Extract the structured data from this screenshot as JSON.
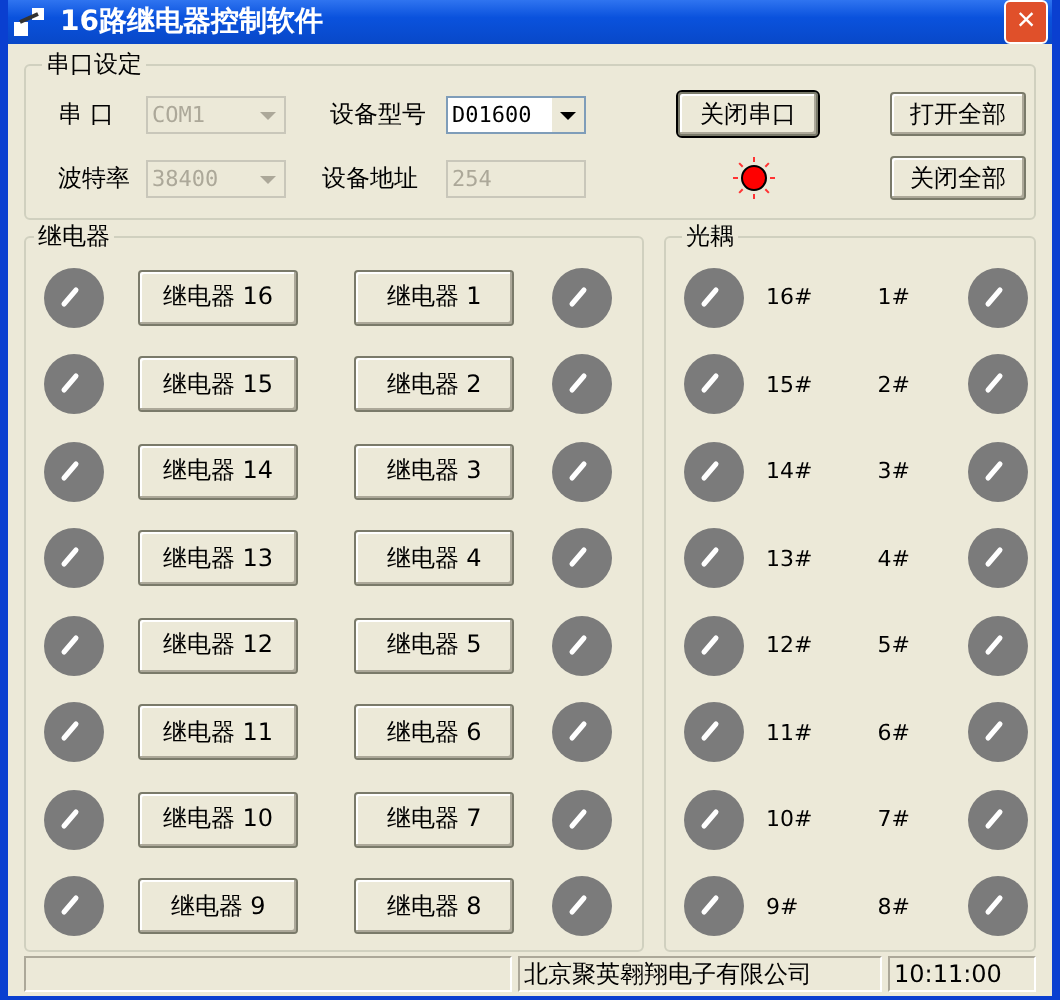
{
  "window": {
    "title": "16路继电器控制软件",
    "close": "×"
  },
  "serial": {
    "title": "串口设定",
    "port": {
      "label": "串 口",
      "value": "COM1",
      "disabled": true
    },
    "model": {
      "label": "设备型号",
      "value": "D01600",
      "disabled": false
    },
    "baud": {
      "label": "波特率",
      "value": "38400",
      "disabled": true
    },
    "address": {
      "label": "设备地址",
      "value": "254",
      "disabled": true
    },
    "toggle_button": "关闭串口",
    "open_all": "打开全部",
    "close_all": "关闭全部",
    "led_on": true
  },
  "relays": {
    "title": "继电器",
    "rows": [
      {
        "left": {
          "label": "继电器 16",
          "on": false
        },
        "right": {
          "label": "继电器 1",
          "on": false
        }
      },
      {
        "left": {
          "label": "继电器 15",
          "on": false
        },
        "right": {
          "label": "继电器 2",
          "on": false
        }
      },
      {
        "left": {
          "label": "继电器 14",
          "on": false
        },
        "right": {
          "label": "继电器 3",
          "on": false
        }
      },
      {
        "left": {
          "label": "继电器 13",
          "on": false
        },
        "right": {
          "label": "继电器 4",
          "on": false
        }
      },
      {
        "left": {
          "label": "继电器 12",
          "on": false
        },
        "right": {
          "label": "继电器 5",
          "on": false
        }
      },
      {
        "left": {
          "label": "继电器 11",
          "on": false
        },
        "right": {
          "label": "继电器 6",
          "on": false
        }
      },
      {
        "left": {
          "label": "继电器 10",
          "on": false
        },
        "right": {
          "label": "继电器 7",
          "on": false
        }
      },
      {
        "left": {
          "label": "继电器 9",
          "on": false
        },
        "right": {
          "label": "继电器 8",
          "on": false
        }
      }
    ]
  },
  "optocouplers": {
    "title": "光耦",
    "rows": [
      {
        "left": {
          "label": "16#",
          "on": false
        },
        "right": {
          "label": "1#",
          "on": false
        }
      },
      {
        "left": {
          "label": "15#",
          "on": false
        },
        "right": {
          "label": "2#",
          "on": false
        }
      },
      {
        "left": {
          "label": "14#",
          "on": false
        },
        "right": {
          "label": "3#",
          "on": false
        }
      },
      {
        "left": {
          "label": "13#",
          "on": false
        },
        "right": {
          "label": "4#",
          "on": false
        }
      },
      {
        "left": {
          "label": "12#",
          "on": false
        },
        "right": {
          "label": "5#",
          "on": false
        }
      },
      {
        "left": {
          "label": "11#",
          "on": false
        },
        "right": {
          "label": "6#",
          "on": false
        }
      },
      {
        "left": {
          "label": "10#",
          "on": false
        },
        "right": {
          "label": "7#",
          "on": false
        }
      },
      {
        "left": {
          "label": "9#",
          "on": false
        },
        "right": {
          "label": "8#",
          "on": false
        }
      }
    ]
  },
  "status_bar": {
    "company": "北京聚英翱翔电子有限公司",
    "time": "10:11:00"
  }
}
